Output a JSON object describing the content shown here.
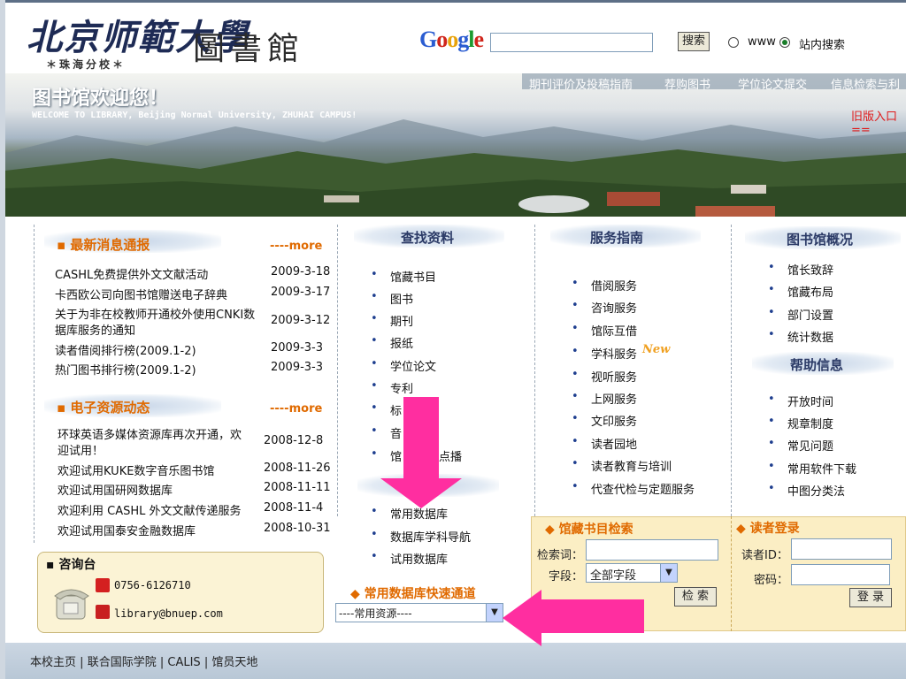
{
  "header": {
    "logo_main": "北京师範大學",
    "logo_lib": "圖書館",
    "logo_sub": "＊珠海分校＊",
    "google": {
      "g1": "G",
      "g2": "o",
      "g3": "o",
      "g4": "g",
      "g5": "l",
      "g6": "e"
    },
    "search_button": "搜索",
    "radio_www": "www",
    "radio_site": "站内搜索"
  },
  "banner": {
    "title": "图书馆欢迎您！",
    "english": "WELCOME TO LIBRARY, Beijing Normal University, ZHUHAI CAMPUS!",
    "nav": [
      "期刊评价及投稿指南",
      "荐购图书",
      "学位论文提交",
      "信息检索与利"
    ],
    "old_entry": "旧版入口=="
  },
  "news": {
    "title": "最新消息通报",
    "more": "more",
    "items": [
      {
        "text": "CASHL免费提供外文文献活动",
        "date": "2009-3-18"
      },
      {
        "text": "卡西欧公司向图书馆赠送电子辞典",
        "date": "2009-3-17"
      },
      {
        "text": "关于为非在校教师开通校外使用CNKI数",
        "text2": "据库服务的通知",
        "date": "2009-3-12"
      },
      {
        "text": "读者借阅排行榜(2009.1-2)",
        "date": "2009-3-3"
      },
      {
        "text": "热门图书排行榜(2009.1-2)",
        "date": "2009-3-3"
      }
    ]
  },
  "eres": {
    "title": "电子资源动态",
    "more": "more",
    "items": [
      {
        "text": "环球英语多媒体资源库再次开通，欢",
        "text2": "迎试用！",
        "date": "2008-12-8"
      },
      {
        "text": "欢迎试用KUKE数字音乐图书馆",
        "date": "2008-11-26"
      },
      {
        "text": "欢迎试用国研网数据库",
        "date": "2008-11-11"
      },
      {
        "text": "欢迎利用 CASHL 外文文献传递服务",
        "date": "2008-11-4"
      },
      {
        "text": "欢迎试用国泰安金融数据库",
        "date": "2008-10-31"
      }
    ]
  },
  "consult": {
    "title": "咨询台",
    "phone": "0756-6126710",
    "email": "library@bnuep.com"
  },
  "find": {
    "title": "查找资料",
    "items": [
      "馆藏书目",
      "图书",
      "期刊",
      "报纸",
      "学位论文",
      "专利",
      "标",
      "音",
      "馆"
    ],
    "partial": "点播",
    "db_items": [
      "常用数据库",
      "数据库学科导航",
      "试用数据库"
    ],
    "quick_title": "常用数据库快速通道",
    "quick_select": "----常用资源----"
  },
  "service": {
    "title": "服务指南",
    "items": [
      "借阅服务",
      "咨询服务",
      "馆际互借",
      "学科服务",
      "视听服务",
      "上网服务",
      "文印服务",
      "读者园地",
      "读者教育与培训",
      "代查代检与定题服务"
    ],
    "new_badge": "New"
  },
  "overview": {
    "title": "图书馆概况",
    "items": [
      "馆长致辞",
      "馆藏布局",
      "部门设置",
      "统计数据"
    ],
    "help_title": "帮助信息",
    "help_items": [
      "开放时间",
      "规章制度",
      "常见问题",
      "常用软件下载",
      "中图分类法"
    ]
  },
  "catalog": {
    "title": "馆藏书目检索",
    "keyword_label": "检索词：",
    "field_label": "字段：",
    "field_value": "全部字段",
    "search_button": "检 索"
  },
  "login": {
    "title": "读者登录",
    "id_label": "读者ID：",
    "pwd_label": "密码：",
    "login_button": "登 录"
  },
  "footer": {
    "links": [
      "本校主页",
      "联合国际学院",
      "CALIS",
      "馆员天地"
    ],
    "sep": "|"
  },
  "colors": {
    "accent_orange": "#e06a00",
    "arrow_pink": "#ff2ea0",
    "heading_blue": "#2b3a66"
  }
}
